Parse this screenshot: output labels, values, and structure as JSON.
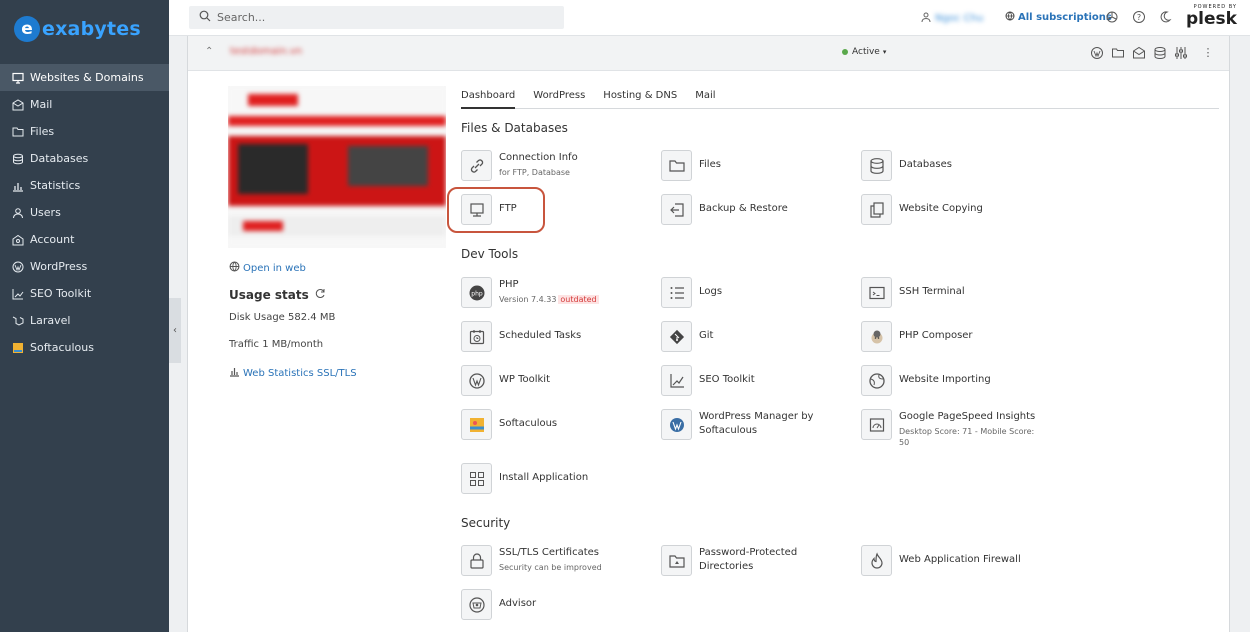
{
  "brand": {
    "logo_letter": "e",
    "logo_text": "exabytes"
  },
  "search": {
    "placeholder": "Search..."
  },
  "topbar": {
    "user": "Ngoc Chu",
    "subscriptions": "All subscriptions",
    "powered_by": "POWERED BY",
    "plesk": "plesk"
  },
  "sidebar": {
    "items": [
      {
        "label": "Websites & Domains",
        "icon": "monitor-icon"
      },
      {
        "label": "Mail",
        "icon": "mail-icon"
      },
      {
        "label": "Files",
        "icon": "folder-icon"
      },
      {
        "label": "Databases",
        "icon": "database-icon"
      },
      {
        "label": "Statistics",
        "icon": "bar-chart-icon"
      },
      {
        "label": "Users",
        "icon": "user-icon"
      },
      {
        "label": "Account",
        "icon": "account-icon"
      },
      {
        "label": "WordPress",
        "icon": "wordpress-icon"
      },
      {
        "label": "SEO Toolkit",
        "icon": "seo-icon"
      },
      {
        "label": "Laravel",
        "icon": "laravel-icon"
      },
      {
        "label": "Softaculous",
        "icon": "softaculous-icon"
      }
    ]
  },
  "domain": {
    "name": "testdomain.vn",
    "status": "Active"
  },
  "left": {
    "open_in_web": "Open in web",
    "usage_title": "Usage stats",
    "disk_label": "Disk Usage",
    "disk_value": "582.4 MB",
    "traffic_label": "Traffic",
    "traffic_value": "1 MB/month",
    "web_stats": "Web Statistics SSL/TLS"
  },
  "tabs": [
    "Dashboard",
    "WordPress",
    "Hosting & DNS",
    "Mail"
  ],
  "sections": {
    "files": {
      "title": "Files & Databases",
      "tools": [
        {
          "name": "Connection Info",
          "sub": "for FTP, Database"
        },
        {
          "name": "Files"
        },
        {
          "name": "Databases"
        },
        {
          "name": "FTP"
        },
        {
          "name": "Backup & Restore"
        },
        {
          "name": "Website Copying"
        }
      ]
    },
    "dev": {
      "title": "Dev Tools",
      "tools": [
        {
          "name": "PHP",
          "sub": "Version 7.4.33",
          "badge": "outdated"
        },
        {
          "name": "Logs"
        },
        {
          "name": "SSH Terminal"
        },
        {
          "name": "Scheduled Tasks"
        },
        {
          "name": "Git"
        },
        {
          "name": "PHP Composer"
        },
        {
          "name": "WP Toolkit"
        },
        {
          "name": "SEO Toolkit"
        },
        {
          "name": "Website Importing"
        },
        {
          "name": "Softaculous"
        },
        {
          "name": "WordPress Manager by",
          "name2": "Softaculous"
        },
        {
          "name": "Google PageSpeed Insights",
          "sub": "Desktop Score: 71 - Mobile Score:",
          "sub2": "50"
        },
        {
          "name": "Install Application"
        }
      ]
    },
    "security": {
      "title": "Security",
      "tools": [
        {
          "name": "SSL/TLS Certificates",
          "sub": "Security can be improved"
        },
        {
          "name": "Password-Protected",
          "name2": "Directories"
        },
        {
          "name": "Web Application Firewall"
        },
        {
          "name": "Advisor"
        }
      ]
    }
  }
}
